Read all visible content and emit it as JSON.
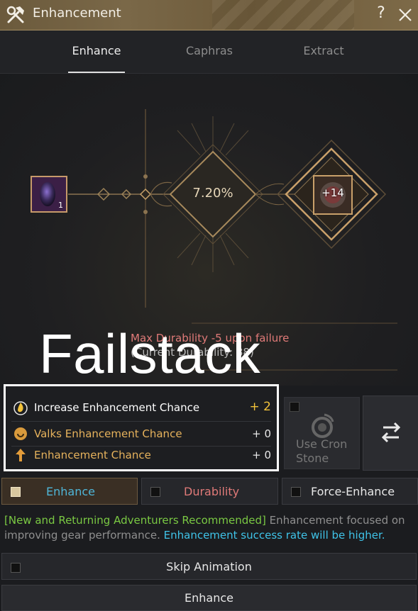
{
  "window": {
    "title": "Enhancement",
    "help_label": "?"
  },
  "tabs": [
    {
      "label": "Enhance",
      "active": true
    },
    {
      "label": "Caphras",
      "active": false
    },
    {
      "label": "Extract",
      "active": false
    }
  ],
  "stage": {
    "material_count": "1",
    "chance": "7.20%",
    "gear_level": "+14"
  },
  "warning": {
    "durability": "Max Durability -5 upon failure",
    "current": "(Current Durability: 88)"
  },
  "overlay_text": "Failstack",
  "bonus": [
    {
      "label": "Increase Enhancement Chance",
      "value": "+ 2",
      "color": "#ffffff",
      "value_color": "#f2c23a",
      "icon": "flame-drop-icon"
    },
    {
      "label": "Valks Enhancement Chance",
      "value": "+ 0",
      "color": "#e6b25c",
      "value_color": "#e8e8e8",
      "icon": "valks-icon"
    },
    {
      "label": "Enhancement Chance",
      "value": "+ 0",
      "color": "#e6b25c",
      "value_color": "#e8e8e8",
      "icon": "arrow-up-icon"
    }
  ],
  "cron": {
    "label_line1": "Use Cron",
    "label_line2": "Stone"
  },
  "modes": {
    "enhance": "Enhance",
    "durability": "Durability",
    "force": "Force-Enhance"
  },
  "description": {
    "green": "[New and Returning Adventurers Recommended]",
    "gray": " Enhancement focused on improving gear performance. ",
    "blue": "Enhancement success rate will be higher."
  },
  "skip_animation": "Skip Animation",
  "enhance_button": "Enhance",
  "colors": {
    "accent_gold": "#c79a6a",
    "enhance_blue": "#4fb6d8",
    "durability_red": "#e07a78",
    "bonus_gold": "#f2c23a"
  }
}
